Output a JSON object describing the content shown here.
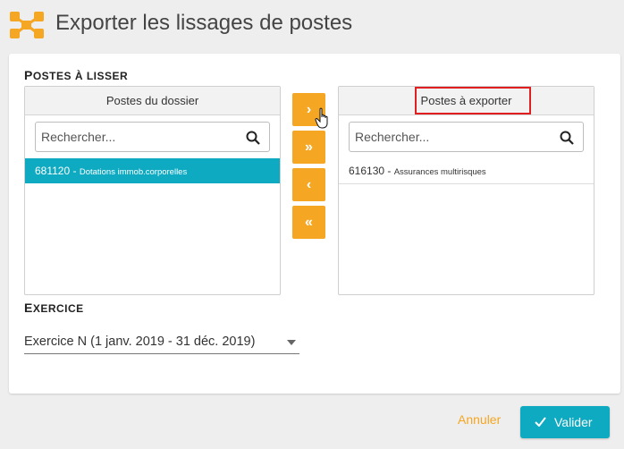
{
  "header": {
    "title": "Exporter les lissages de postes",
    "logo_icon": "network-nodes-icon"
  },
  "section_postes": {
    "label_first": "P",
    "label_rest": "OSTES À LISSER"
  },
  "left_panel": {
    "title": "Postes du dossier",
    "search_placeholder": "Rechercher...",
    "items": [
      {
        "code": "681120",
        "sep": " - ",
        "label": "Dotations immob.corporelles",
        "selected": true
      }
    ]
  },
  "right_panel": {
    "title": "Postes à exporter",
    "search_placeholder": "Rechercher...",
    "items": [
      {
        "code": "616130",
        "sep": " - ",
        "label": "Assurances multirisques",
        "selected": false
      }
    ]
  },
  "transfer_buttons": [
    {
      "glyph": "›",
      "icon": "chevron-right-icon"
    },
    {
      "glyph": "»",
      "icon": "double-chevron-right-icon"
    },
    {
      "glyph": "‹",
      "icon": "chevron-left-icon"
    },
    {
      "glyph": "«",
      "icon": "double-chevron-left-icon"
    }
  ],
  "section_exercice": {
    "label_first": "E",
    "label_rest": "XERCICE"
  },
  "exercice_select": {
    "value": "Exercice N (1 janv. 2019 - 31 déc. 2019)"
  },
  "footer": {
    "cancel_label": "Annuler",
    "validate_label": "Valider"
  },
  "colors": {
    "accent_orange": "#f5a623",
    "accent_teal": "#0eaac1",
    "highlight_red": "#e02020"
  }
}
